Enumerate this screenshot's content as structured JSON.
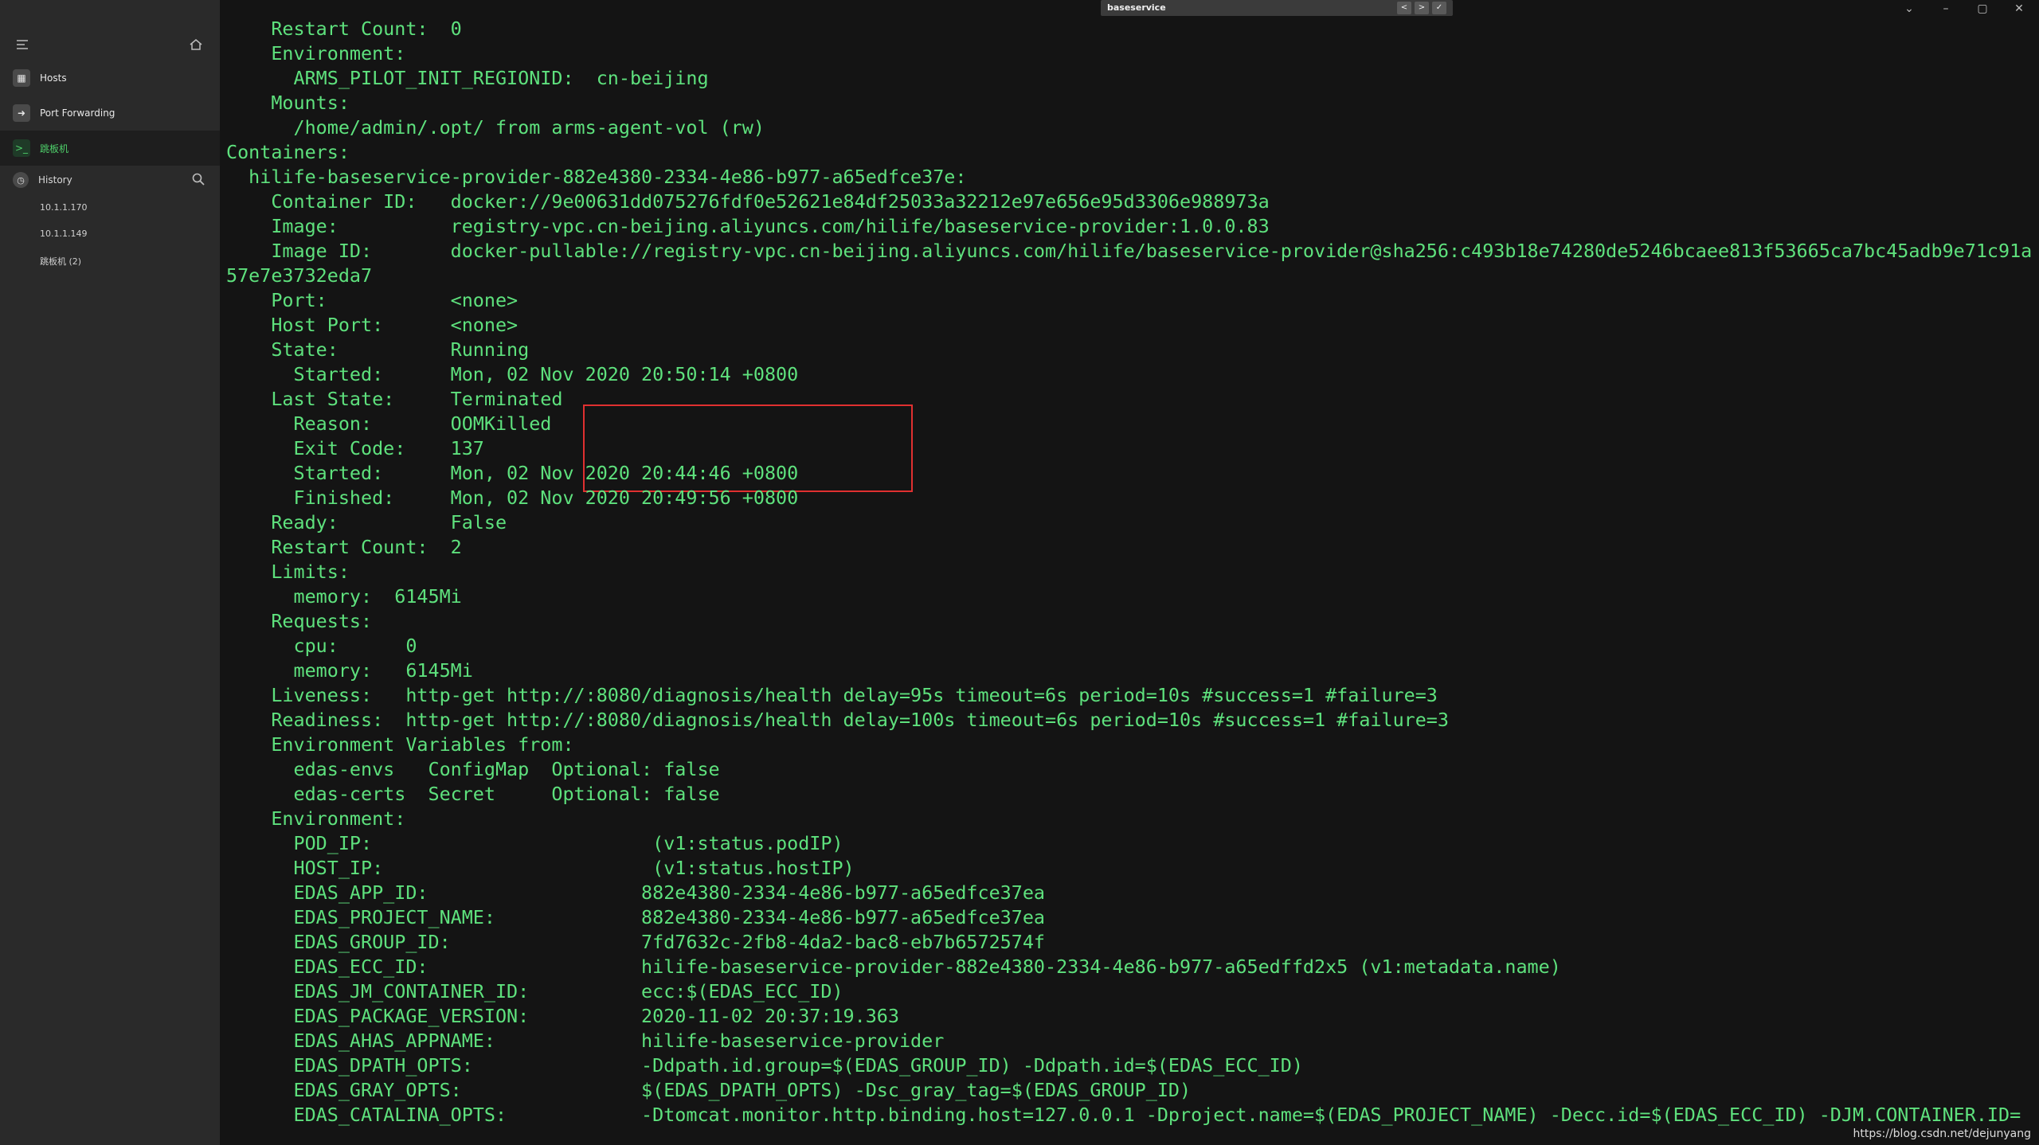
{
  "sidebar": {
    "items": [
      {
        "label": "Hosts",
        "icon": "grid-icon"
      },
      {
        "label": "Port Forwarding",
        "icon": "forward-arrow-icon"
      },
      {
        "label": "跳板机",
        "icon": "terminal-icon"
      }
    ],
    "history": {
      "label": "History",
      "items": [
        "10.1.1.170",
        "10.1.1.149",
        "跳板机 (2)"
      ]
    }
  },
  "titlebar": {
    "tab_title": "baseservice",
    "prev_label": "<",
    "next_label": ">",
    "check_label": "✓"
  },
  "terminal": {
    "text_color": "#5ee17d",
    "lines": [
      "    Restart Count:  0",
      "    Environment:",
      "      ARMS_PILOT_INIT_REGIONID:  cn-beijing",
      "    Mounts:",
      "      /home/admin/.opt/ from arms-agent-vol (rw)",
      "Containers:",
      "  hilife-baseservice-provider-882e4380-2334-4e86-b977-a65edfce37e:",
      "    Container ID:   docker://9e00631dd075276fdf0e52621e84df25033a32212e97e656e95d3306e988973a",
      "    Image:          registry-vpc.cn-beijing.aliyuncs.com/hilife/baseservice-provider:1.0.0.83",
      "    Image ID:       docker-pullable://registry-vpc.cn-beijing.aliyuncs.com/hilife/baseservice-provider@sha256:c493b18e74280de5246bcaee813f53665ca7bc45adb9e71c91a",
      "57e7e3732eda7",
      "    Port:           <none>",
      "    Host Port:      <none>",
      "    State:          Running",
      "      Started:      Mon, 02 Nov 2020 20:50:14 +0800",
      "    Last State:     Terminated",
      "      Reason:       OOMKilled",
      "      Exit Code:    137",
      "      Started:      Mon, 02 Nov 2020 20:44:46 +0800",
      "      Finished:     Mon, 02 Nov 2020 20:49:56 +0800",
      "    Ready:          False",
      "    Restart Count:  2",
      "    Limits:",
      "      memory:  6145Mi",
      "    Requests:",
      "      cpu:      0",
      "      memory:   6145Mi",
      "    Liveness:   http-get http://:8080/diagnosis/health delay=95s timeout=6s period=10s #success=1 #failure=3",
      "    Readiness:  http-get http://:8080/diagnosis/health delay=100s timeout=6s period=10s #success=1 #failure=3",
      "    Environment Variables from:",
      "      edas-envs   ConfigMap  Optional: false",
      "      edas-certs  Secret     Optional: false",
      "    Environment:",
      "      POD_IP:                         (v1:status.podIP)",
      "      HOST_IP:                        (v1:status.hostIP)",
      "      EDAS_APP_ID:                   882e4380-2334-4e86-b977-a65edfce37ea",
      "      EDAS_PROJECT_NAME:             882e4380-2334-4e86-b977-a65edfce37ea",
      "      EDAS_GROUP_ID:                 7fd7632c-2fb8-4da2-bac8-eb7b6572574f",
      "      EDAS_ECC_ID:                   hilife-baseservice-provider-882e4380-2334-4e86-b977-a65edffd2x5 (v1:metadata.name)",
      "      EDAS_JM_CONTAINER_ID:          ecc:$(EDAS_ECC_ID)",
      "      EDAS_PACKAGE_VERSION:          2020-11-02 20:37:19.363",
      "      EDAS_AHAS_APPNAME:             hilife-baseservice-provider",
      "      EDAS_DPATH_OPTS:               -Ddpath.id.group=$(EDAS_GROUP_ID) -Ddpath.id=$(EDAS_ECC_ID)",
      "      EDAS_GRAY_OPTS:                $(EDAS_DPATH_OPTS) -Dsc_gray_tag=$(EDAS_GROUP_ID)",
      "      EDAS_CATALINA_OPTS:            -Dtomcat.monitor.http.binding.host=127.0.0.1 -Dproject.name=$(EDAS_PROJECT_NAME) -Decc.id=$(EDAS_ECC_ID) -DJM.CONTAINER.ID="
    ]
  },
  "watermark": "https://blog.csdn.net/dejunyang"
}
